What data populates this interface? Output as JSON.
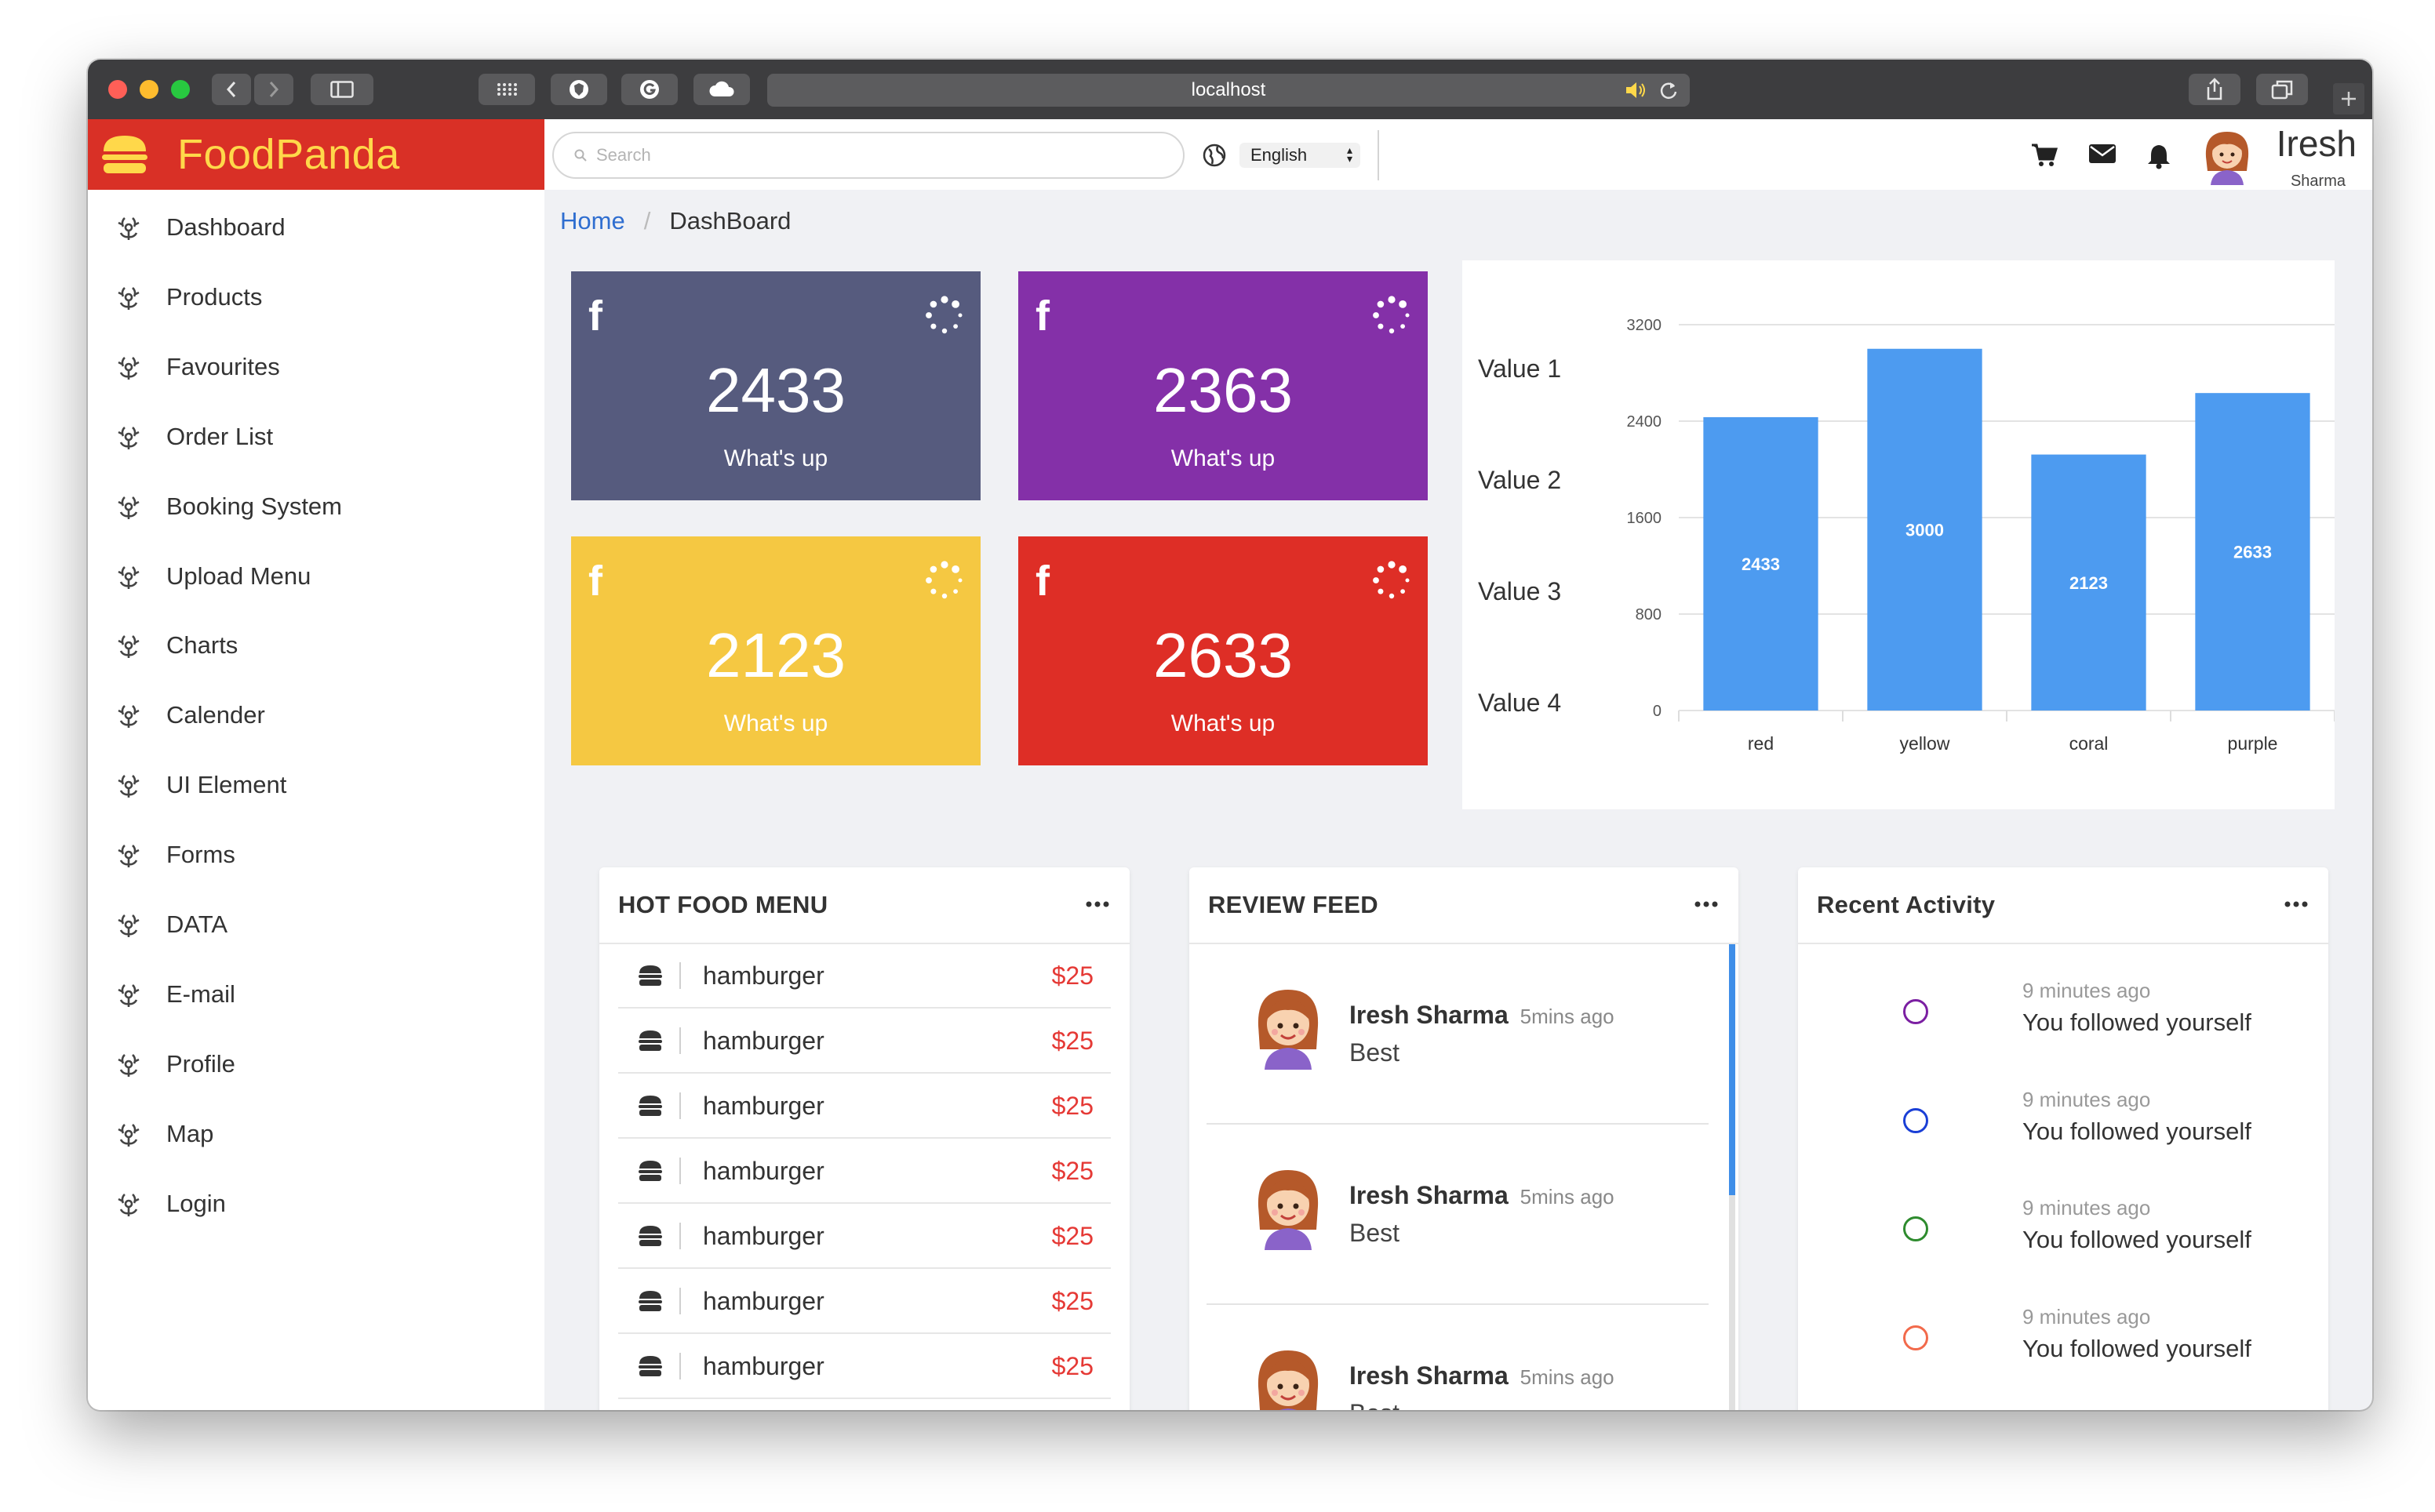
{
  "browser": {
    "url": "localhost"
  },
  "brand": {
    "name": "FoodPanda"
  },
  "topbar": {
    "search_placeholder": "Search",
    "language": "English",
    "user": {
      "name": "Iresh",
      "subtitle": "Sharma"
    }
  },
  "sidebar": {
    "items": [
      {
        "label": "Dashboard"
      },
      {
        "label": "Products"
      },
      {
        "label": "Favourites"
      },
      {
        "label": "Order List"
      },
      {
        "label": "Booking System"
      },
      {
        "label": "Upload Menu"
      },
      {
        "label": "Charts"
      },
      {
        "label": "Calender"
      },
      {
        "label": "UI Element"
      },
      {
        "label": "Forms"
      },
      {
        "label": "DATA"
      },
      {
        "label": "E-mail"
      },
      {
        "label": "Profile"
      },
      {
        "label": "Map"
      },
      {
        "label": "Login"
      }
    ]
  },
  "breadcrumb": {
    "home": "Home",
    "separator": "/",
    "current": "DashBoard"
  },
  "stats": [
    {
      "icon": "facebook-icon",
      "value": "2433",
      "label": "What's up",
      "color": "#565b7e"
    },
    {
      "icon": "facebook-icon",
      "value": "2363",
      "label": "What's up",
      "color": "#8430a8"
    },
    {
      "icon": "facebook-icon",
      "value": "2123",
      "label": "What's up",
      "color": "#f5c842"
    },
    {
      "icon": "facebook-icon",
      "value": "2633",
      "label": "What's up",
      "color": "#de2e26"
    }
  ],
  "chart_labels": [
    "Value 1",
    "Value 2",
    "Value 3",
    "Value 4"
  ],
  "chart_data": {
    "type": "bar",
    "categories": [
      "red",
      "yellow",
      "coral",
      "purple"
    ],
    "values": [
      2433,
      3000,
      2123,
      2633
    ],
    "yticks": [
      0,
      800,
      1600,
      2400,
      3200
    ],
    "ylim": [
      0,
      3200
    ],
    "bar_color": "#4d9bf0",
    "data_labels": true
  },
  "hot_food": {
    "title": "HOT FOOD MENU",
    "items": [
      {
        "name": "hamburger",
        "price": "$25"
      },
      {
        "name": "hamburger",
        "price": "$25"
      },
      {
        "name": "hamburger",
        "price": "$25"
      },
      {
        "name": "hamburger",
        "price": "$25"
      },
      {
        "name": "hamburger",
        "price": "$25"
      },
      {
        "name": "hamburger",
        "price": "$25"
      },
      {
        "name": "hamburger",
        "price": "$25"
      }
    ]
  },
  "review_feed": {
    "title": "REVIEW FEED",
    "items": [
      {
        "name": "Iresh Sharma",
        "time": "5mins ago",
        "text": "Best"
      },
      {
        "name": "Iresh Sharma",
        "time": "5mins ago",
        "text": "Best"
      },
      {
        "name": "Iresh Sharma",
        "time": "5mins ago",
        "text": "Best"
      }
    ]
  },
  "recent_activity": {
    "title": "Recent Activity",
    "items": [
      {
        "time": "9 minutes ago",
        "text": "You followed yourself",
        "color": "#7b1fa2"
      },
      {
        "time": "9 minutes ago",
        "text": "You followed yourself",
        "color": "#1a3fd6"
      },
      {
        "time": "9 minutes ago",
        "text": "You followed yourself",
        "color": "#2e8b2e"
      },
      {
        "time": "9 minutes ago",
        "text": "You followed yourself",
        "color": "#f26a4b"
      }
    ]
  }
}
